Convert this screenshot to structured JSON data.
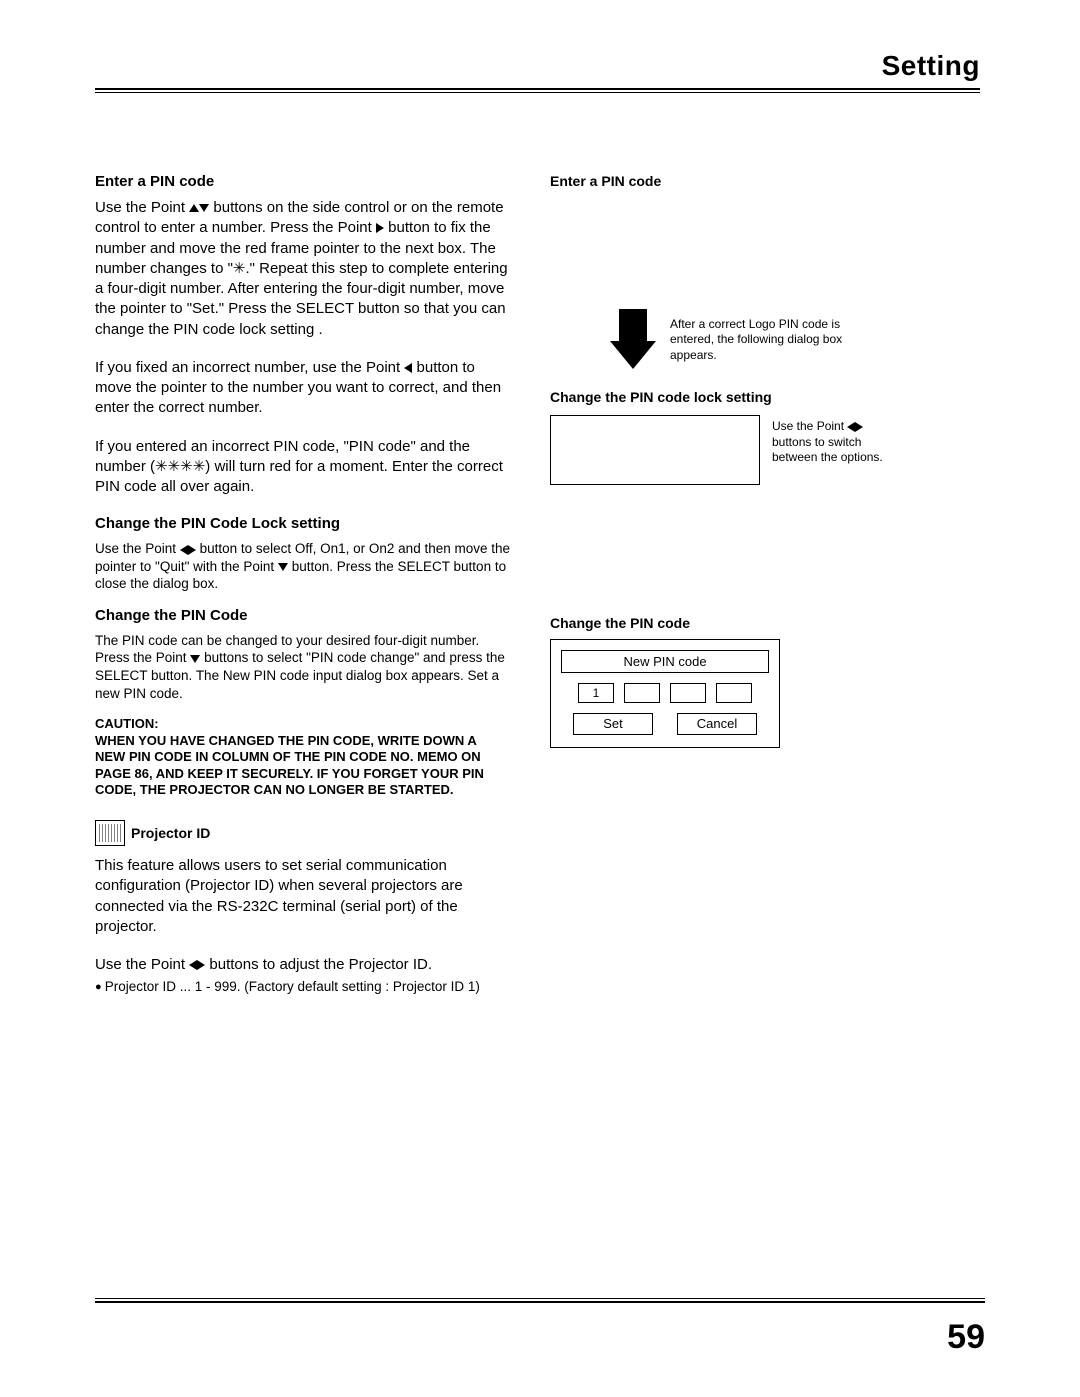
{
  "header": {
    "title": "Setting"
  },
  "page_number": "59",
  "left": {
    "sec1_h": "Enter a PIN code",
    "sec1_p1a": "Use the Point ",
    "sec1_p1b": " buttons on the side control or on the remote control to enter a number. Press the Point ",
    "sec1_p1c": " button to fix the number and move the red frame pointer to the next box. The number changes to \"✳.\" Repeat this step to complete entering a four-digit number. After entering the four-digit number, move the pointer to \"Set.\" Press the SELECT button so that you can change the PIN code lock setting .",
    "sec1_p2a": " If you fixed an incorrect number, use the Point ",
    "sec1_p2b": " button to move the pointer to the number you want to correct, and then enter the correct number.",
    "sec1_p3": "If you entered an incorrect PIN code, \"PIN code\" and the number (✳✳✳✳) will turn red for a moment. Enter the correct PIN code all over again.",
    "sec2_h": "Change the PIN Code Lock setting",
    "sec2_p_a": "Use the Point ",
    "sec2_p_b": " button to select Off, On1, or On2 and then move the pointer to \"Quit\" with the Point ",
    "sec2_p_c": " button. Press the SELECT button to close the dialog box.",
    "sec3_h": "Change the PIN Code",
    "sec3_p_a": "The PIN code can be changed to your desired four-digit number. Press the Point ",
    "sec3_p_b": " buttons to select \"PIN code change\" and press the SELECT button. The New PIN code input dialog box appears. Set a new PIN code.",
    "caution_label": "CAUTION:",
    "caution_text": "WHEN YOU HAVE CHANGED THE PIN CODE, WRITE DOWN A NEW PIN CODE IN COLUMN OF THE PIN CODE NO. MEMO ON PAGE 86, AND KEEP IT SECURELY. IF YOU FORGET YOUR PIN CODE, THE PROJECTOR CAN NO LONGER BE STARTED.",
    "projector_label": "Projector ID",
    "proj_p1": "This feature allows users to set serial communication configuration (Projector ID) when several projectors are connected via the RS-232C terminal (serial port) of the projector.",
    "proj_p2a": "Use the Point ",
    "proj_p2b": " buttons to adjust the Projector ID.",
    "proj_bullet": "Projector ID ... 1 - 999. (Factory default setting : Projector ID 1)"
  },
  "right": {
    "enter_h": "Enter a PIN code",
    "arrow_caption": "After a correct Logo PIN code is entered, the following dialog box appears.",
    "lock_h": "Change the PIN code lock setting",
    "lock_caption_a": "Use the Point ",
    "lock_caption_b": " buttons to switch between the options.",
    "change_h": "Change the PIN code",
    "dialog": {
      "title": "New PIN code",
      "field1": "1",
      "set": "Set",
      "cancel": "Cancel"
    }
  }
}
